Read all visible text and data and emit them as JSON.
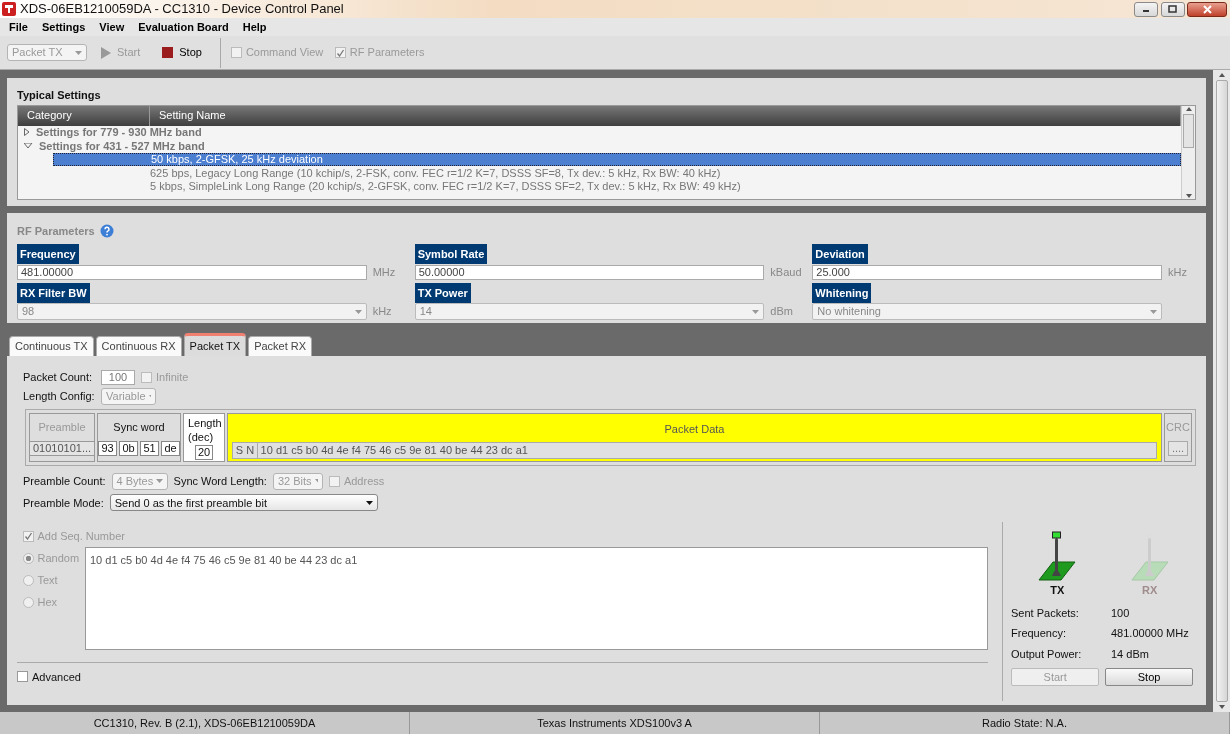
{
  "window": {
    "title": "XDS-06EB1210059DA - CC1310 - Device Control Panel"
  },
  "menu": [
    "File",
    "Settings",
    "View",
    "Evaluation Board",
    "Help"
  ],
  "toolbar": {
    "mode": {
      "value": "Packet TX",
      "disabled": true
    },
    "buttons": [
      {
        "kind": "start",
        "label": "Start",
        "disabled": true
      },
      {
        "kind": "stop",
        "label": "Stop",
        "disabled": false
      }
    ],
    "checks": [
      {
        "label": "Command View",
        "checked": false,
        "disabled": true
      },
      {
        "label": "RF Parameters",
        "checked": true,
        "disabled": true
      }
    ]
  },
  "typical_settings": {
    "title": "Typical Settings",
    "columns": [
      "Category",
      "Setting Name"
    ],
    "groups": [
      {
        "label": "Settings for 779 - 930 MHz band",
        "expanded": false
      },
      {
        "label": "Settings for 431 - 527 MHz band",
        "expanded": true,
        "children": [
          {
            "label": "50 kbps, 2-GFSK, 25 kHz deviation",
            "selected": true
          },
          {
            "label": "625 bps, Legacy Long Range (10 kchip/s, 2-FSK, conv. FEC r=1/2 K=7, DSSS SF=8, Tx dev.: 5 kHz, Rx BW: 40 kHz)",
            "selected": false
          },
          {
            "label": "5 kbps, SimpleLink Long Range (20 kchip/s, 2-GFSK, conv. FEC r=1/2 K=7, DSSS SF=2, Tx dev.: 5 kHz, Rx BW: 49 kHz)",
            "selected": false
          }
        ]
      }
    ]
  },
  "rf_parameters": {
    "title": "RF Parameters",
    "fields": [
      {
        "label": "Frequency",
        "kind": "input",
        "value": "481.00000",
        "unit": "MHz"
      },
      {
        "label": "Symbol Rate",
        "kind": "input",
        "value": "50.00000",
        "unit": "kBaud"
      },
      {
        "label": "Deviation",
        "kind": "input",
        "value": "25.000",
        "unit": "kHz"
      },
      {
        "label": "RX Filter BW",
        "kind": "select",
        "value": "98",
        "unit": "kHz"
      },
      {
        "label": "TX Power",
        "kind": "select",
        "value": "14",
        "unit": "dBm"
      },
      {
        "label": "Whitening",
        "kind": "select",
        "value": "No whitening"
      }
    ]
  },
  "tabs": [
    {
      "label": "Continuous TX",
      "selected": false
    },
    {
      "label": "Continuous RX",
      "selected": false
    },
    {
      "label": "Packet TX",
      "selected": true
    },
    {
      "label": "Packet RX",
      "selected": false
    }
  ],
  "packet_tx": {
    "packet_count": {
      "label": "Packet Count:",
      "value": "100",
      "infinite": {
        "label": "Infinite",
        "checked": false
      }
    },
    "length_config": {
      "label": "Length Config:",
      "value": "Variable"
    },
    "frame": {
      "preamble": {
        "label": "Preamble",
        "value": "01010101..."
      },
      "sync_word": {
        "label": "Sync word",
        "bytes": [
          "93",
          "0b",
          "51",
          "de"
        ]
      },
      "length": {
        "label": "Length (dec)",
        "value": "20"
      },
      "packet_data": {
        "label": "Packet Data",
        "prefix": "S N",
        "value": "10 d1 c5 b0 4d 4e f4 75 46 c5 9e 81 40 be 44 23 dc a1"
      },
      "crc": {
        "label": "CRC",
        "value": "...."
      }
    },
    "preamble_count": {
      "label": "Preamble Count:",
      "value": "4 Bytes"
    },
    "sync_word_length": {
      "label": "Sync Word Length:",
      "value": "32 Bits"
    },
    "address": {
      "label": "Address",
      "checked": false
    },
    "preamble_mode": {
      "label": "Preamble Mode:",
      "value": "Send 0 as the first preamble bit"
    },
    "add_seq": {
      "label": "Add Seq. Number",
      "checked": true
    },
    "sources": [
      {
        "label": "Random",
        "selected": true
      },
      {
        "label": "Text",
        "selected": false
      },
      {
        "label": "Hex",
        "selected": false
      }
    ],
    "payload": "10 d1 c5 b0 4d 4e f4 75 46 c5 9e 81 40 be 44 23 dc a1",
    "advanced": {
      "label": "Advanced",
      "checked": false
    }
  },
  "status_panel": {
    "indicators": [
      {
        "label": "TX",
        "on": true
      },
      {
        "label": "RX",
        "on": false
      }
    ],
    "stats": [
      {
        "label": "Sent Packets:",
        "value": "100"
      },
      {
        "label": "Frequency:",
        "value": "481.00000 MHz"
      },
      {
        "label": "Output Power:",
        "value": "14 dBm"
      }
    ],
    "buttons": [
      {
        "label": "Start",
        "disabled": true
      },
      {
        "label": "Stop",
        "disabled": false
      }
    ]
  },
  "status_bar": [
    "CC1310, Rev. B (2.1), XDS-06EB1210059DA",
    "Texas Instruments XDS100v3 A",
    "Radio State: N.A."
  ]
}
